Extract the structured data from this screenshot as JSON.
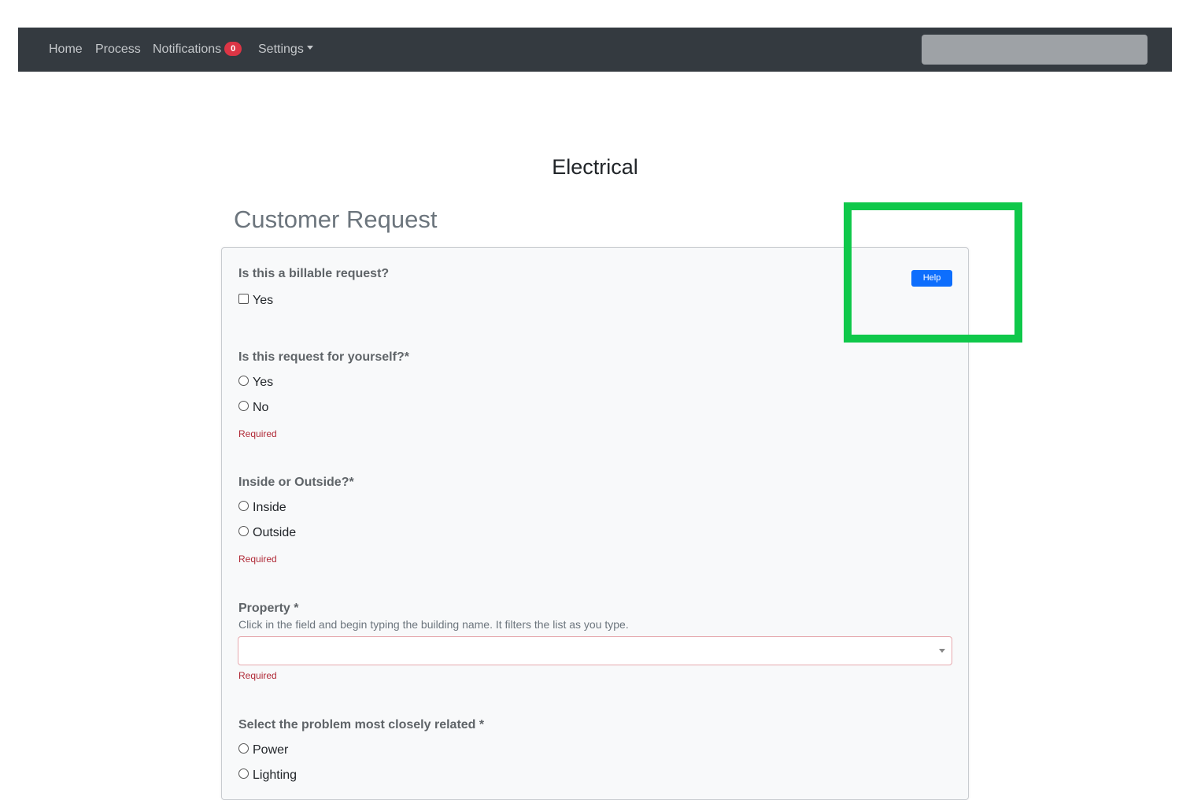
{
  "navbar": {
    "items": [
      "Home",
      "Process",
      "Notifications",
      "Settings"
    ],
    "notifications_count": "0",
    "search_value": ""
  },
  "page": {
    "title": "Electrical",
    "section_heading": "Customer Request"
  },
  "form": {
    "help_button": "Help",
    "billable": {
      "label": "Is this a billable request?",
      "option": "Yes"
    },
    "for_yourself": {
      "label": "Is this request for yourself?*",
      "options": [
        "Yes",
        "No"
      ],
      "required": "Required"
    },
    "inside_outside": {
      "label": "Inside or Outside?*",
      "options": [
        "Inside",
        "Outside"
      ],
      "required": "Required"
    },
    "property": {
      "label": "Property *",
      "help": "Click in the field and begin typing the building name. It filters the list as you type.",
      "value": "",
      "required": "Required"
    },
    "problem": {
      "label": "Select the problem most closely related *",
      "options": [
        "Power",
        "Lighting"
      ]
    }
  },
  "colors": {
    "navbar_bg": "#343a40",
    "highlight": "#0fc84a",
    "help_button": "#0d6efd",
    "required_text": "#b02a37"
  },
  "icons": [
    "checkbox-icon",
    "radio-icon",
    "caret-down-icon"
  ]
}
